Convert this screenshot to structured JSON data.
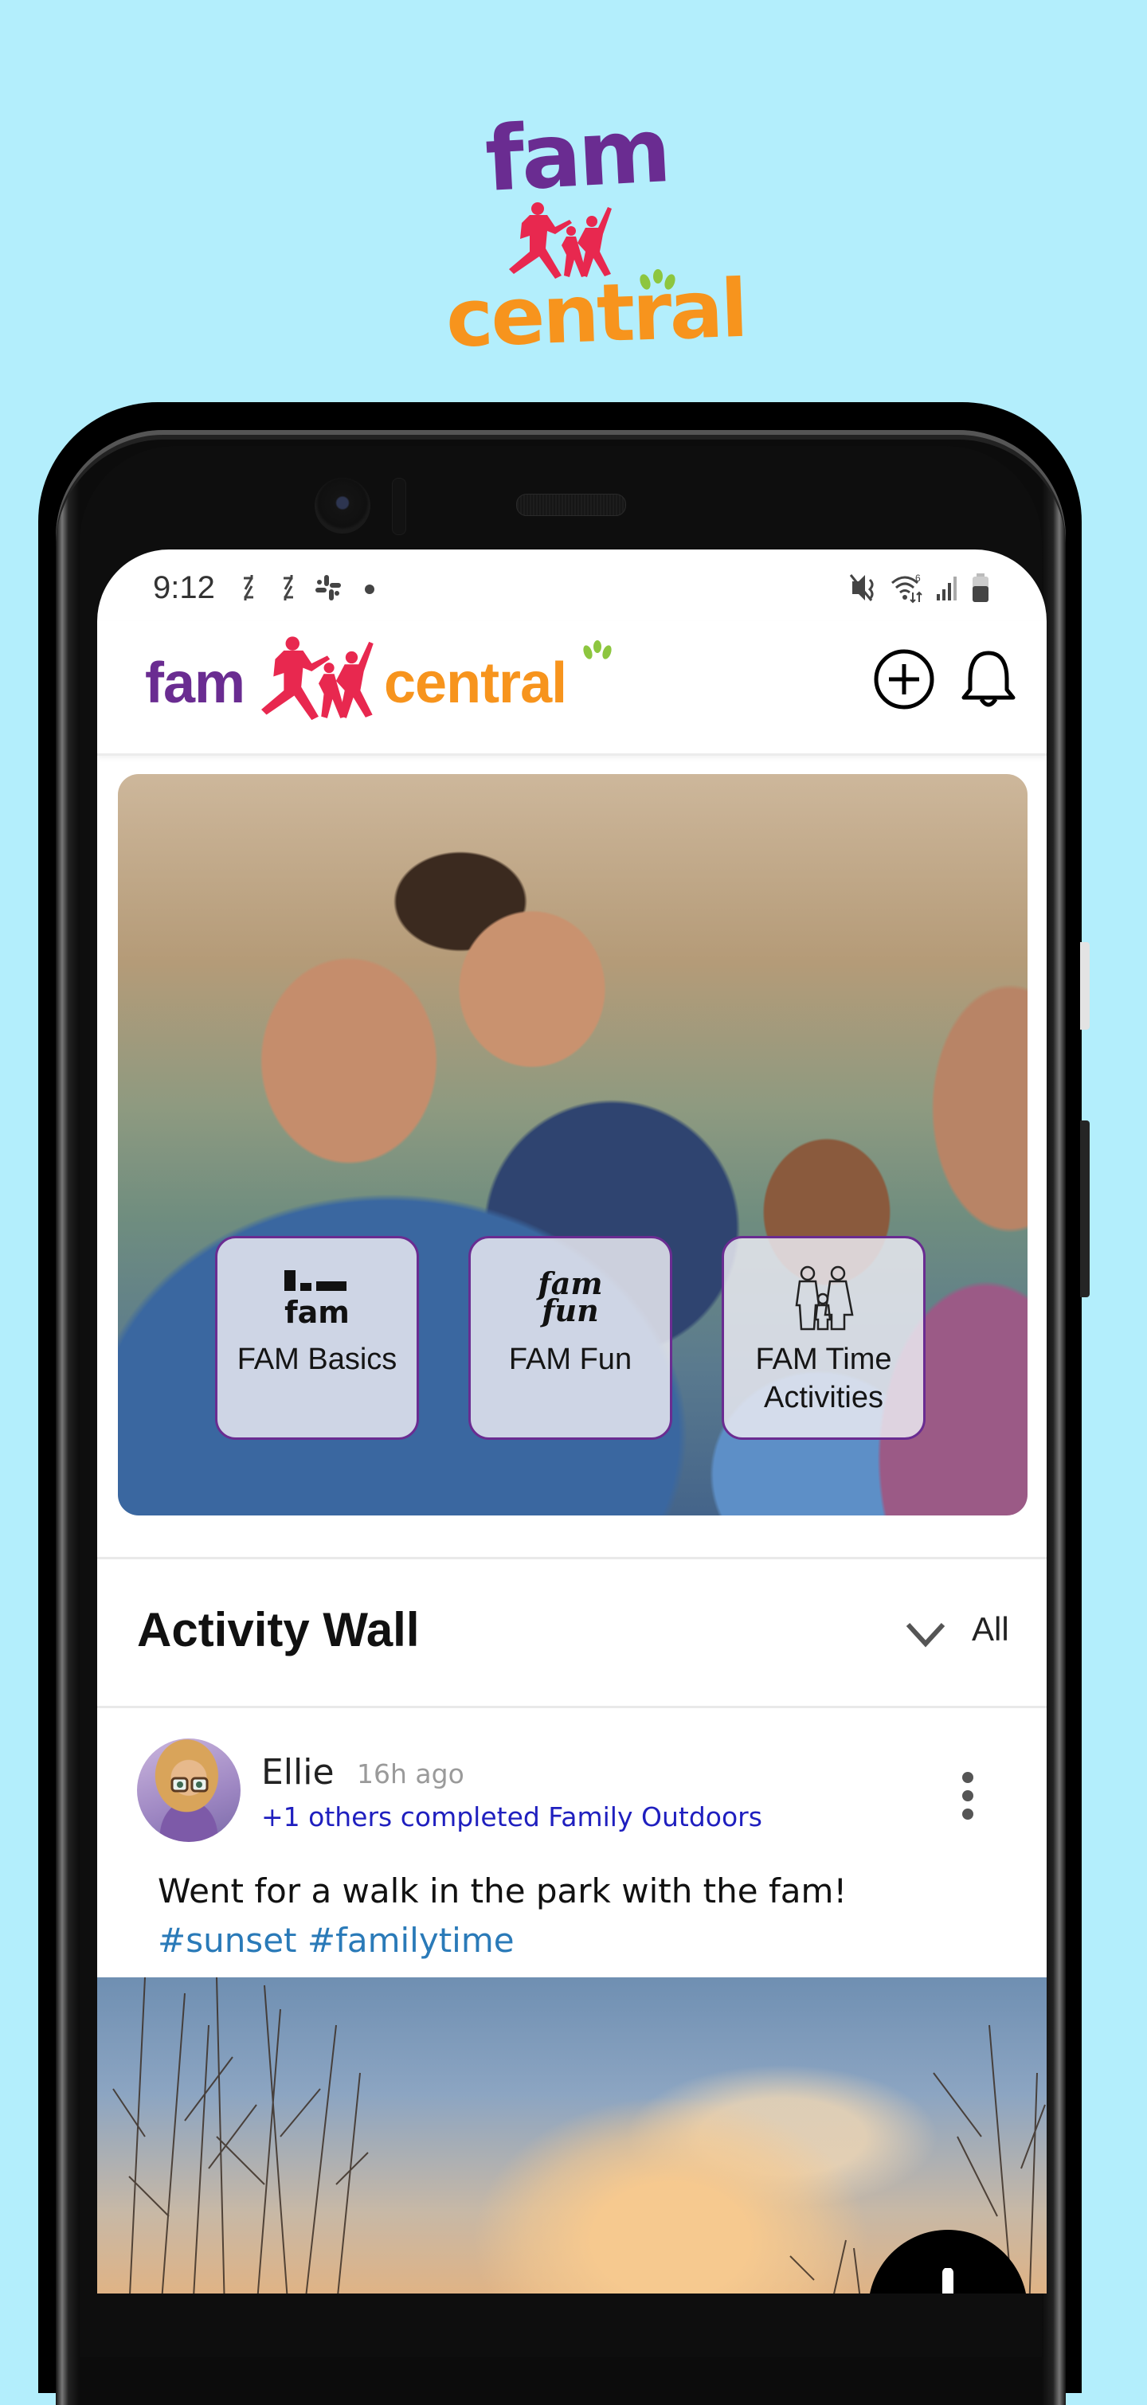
{
  "promo": {
    "logo_word_top": "fam",
    "logo_word_bottom": "central"
  },
  "status_bar": {
    "time": "9:12",
    "left_icons": [
      "sync-icon",
      "sync-icon",
      "slack-icon",
      "notification-dot-icon"
    ],
    "right_icons": [
      "vibrate-mute-icon",
      "wifi-6-icon",
      "signal-icon",
      "battery-icon"
    ]
  },
  "header": {
    "logo_word_left": "fam",
    "logo_word_right": "central",
    "add_button_icon": "plus-circle-icon",
    "notifications_button_icon": "bell-icon"
  },
  "colors": {
    "brand_purple": "#6a2c91",
    "brand_orange": "#f7941d",
    "brand_pink": "#e8284f",
    "brand_green": "#8dc63f",
    "link_blue": "#1f1fbf",
    "hashtag_blue": "#2a7ab8",
    "page_background": "#b3eefc"
  },
  "hero": {
    "image_alt": "Smiling family outdoors",
    "tiles": [
      {
        "label": "FAM Basics",
        "icon": "fam-basics-icon",
        "icon_text": "fam"
      },
      {
        "label": "FAM Fun",
        "icon": "fam-fun-icon",
        "icon_text_line1": "fam",
        "icon_text_line2": "fun"
      },
      {
        "label": "FAM Time Activities",
        "label_line1": "FAM Time",
        "label_line2": "Activities",
        "icon": "family-icon"
      }
    ]
  },
  "activity_wall": {
    "title": "Activity Wall",
    "filter_label": "All",
    "filter_icon": "chevron-down-icon"
  },
  "posts": [
    {
      "author": "Ellie",
      "time_ago": "16h ago",
      "subline": "+1 others completed Family Outdoors",
      "text": "Went for a walk in the park with the fam!",
      "hashtags": [
        "#sunset",
        "#familytime"
      ],
      "image_alt": "Sunset sky with bare trees",
      "menu_icon": "more-vertical-icon"
    }
  ],
  "fab": {
    "icon": "plus-icon"
  }
}
